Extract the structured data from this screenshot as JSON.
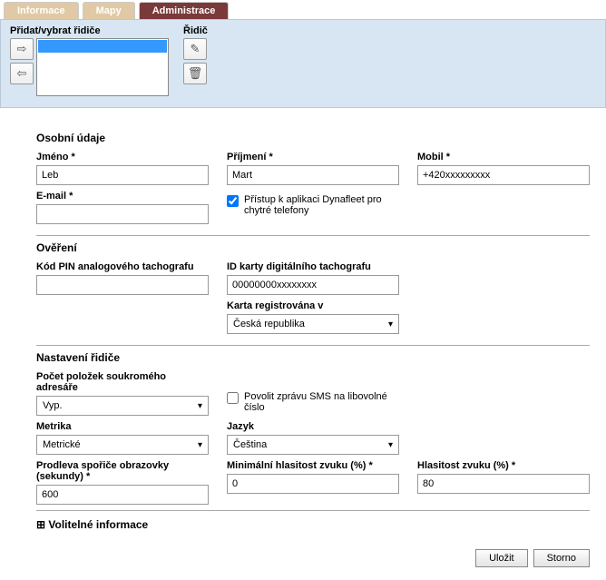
{
  "tabs": {
    "info": "Informace",
    "maps": "Mapy",
    "admin": "Administrace"
  },
  "topPanel": {
    "addSelectDriverLabel": "Přidat/vybrat řidiče",
    "driverLabel": "Řidič"
  },
  "section1": {
    "title": "Osobní údaje",
    "nameLabel": "Jméno *",
    "nameValue": "Leb",
    "surnameLabel": "Příjmení *",
    "surnameValue": "Mart",
    "mobileLabel": "Mobil *",
    "mobileValue": "+420xxxxxxxxx",
    "emailLabel": "E-mail *",
    "emailValue": "",
    "smartphoneAccessLabel": "Přístup k aplikaci Dynafleet pro chytré telefony"
  },
  "section2": {
    "title": "Ověření",
    "pinLabel": "Kód PIN analogového tachografu",
    "pinValue": "",
    "cardIdLabel": "ID karty digitálního tachografu",
    "cardIdValue": "00000000xxxxxxxx",
    "cardRegLabel": "Karta registrována v",
    "cardRegValue": "Česká republika"
  },
  "section3": {
    "title": "Nastavení řidiče",
    "privateAddrLabel": "Počet položek soukromého adresáře",
    "privateAddrValue": "Vyp.",
    "allowSmsLabel": "Povolit zprávu SMS na libovolné číslo",
    "metricLabel": "Metrika",
    "metricValue": "Metrické",
    "langLabel": "Jazyk",
    "langValue": "Čeština",
    "screensaverLabel": "Prodleva spořiče obrazovky (sekundy) *",
    "screensaverValue": "600",
    "minVolLabel": "Minimální hlasitost zvuku (%) *",
    "minVolValue": "0",
    "volLabel": "Hlasitost zvuku (%) *",
    "volValue": "80"
  },
  "optional": {
    "title": "Volitelné informace"
  },
  "footer": {
    "save": "Uložit",
    "cancel": "Storno"
  }
}
